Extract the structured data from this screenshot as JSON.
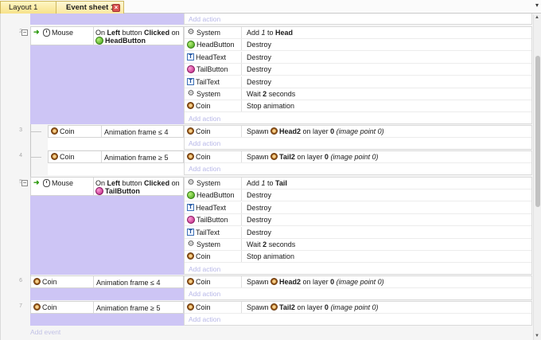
{
  "tabs": [
    {
      "label": "Layout 1"
    },
    {
      "label": "Event sheet 1"
    }
  ],
  "tab_menu_glyph": "▾",
  "tab_close_glyph": "×",
  "add_action_label": "Add action",
  "add_event_label": "Add event",
  "collapse_glyph": "−",
  "events": [
    {
      "num": "2",
      "cond_object": "Mouse",
      "cond_parts": [
        "On ",
        "Left",
        " button ",
        "Clicked",
        " on"
      ],
      "cond_target": "HeadButton",
      "actions": [
        {
          "icon": "gear-icon",
          "object": "System",
          "text": [
            "Add ",
            "1",
            " to ",
            "Head"
          ]
        },
        {
          "icon": "green-button-icon",
          "object": "HeadButton",
          "text": [
            "Destroy"
          ]
        },
        {
          "icon": "text-icon",
          "object": "HeadText",
          "text": [
            "Destroy"
          ]
        },
        {
          "icon": "pink-button-icon",
          "object": "TailButton",
          "text": [
            "Destroy"
          ]
        },
        {
          "icon": "text-icon",
          "object": "TailText",
          "text": [
            "Destroy"
          ]
        },
        {
          "icon": "gear-icon",
          "object": "System",
          "text": [
            "Wait ",
            "2",
            " seconds"
          ]
        },
        {
          "icon": "coin-icon",
          "object": "Coin",
          "text": [
            "Stop animation"
          ]
        }
      ]
    },
    {
      "num": "3",
      "cond_object": "Coin",
      "cond_text": "Animation frame ≤ 4",
      "actions": [
        {
          "icon": "coin-icon",
          "object": "Coin",
          "text": [
            "Spawn ",
            "Head2",
            " on layer ",
            "0",
            " ",
            "(image point 0)"
          ]
        }
      ]
    },
    {
      "num": "4",
      "cond_object": "Coin",
      "cond_text": "Animation frame ≥ 5",
      "actions": [
        {
          "icon": "coin-icon",
          "object": "Coin",
          "text": [
            "Spawn ",
            "Tail2",
            " on layer ",
            "0",
            " ",
            "(image point 0)"
          ]
        }
      ]
    },
    {
      "num": "5",
      "cond_object": "Mouse",
      "cond_parts": [
        "On ",
        "Left",
        " button ",
        "Clicked",
        " on"
      ],
      "cond_target": "TailButton",
      "actions": [
        {
          "icon": "gear-icon",
          "object": "System",
          "text": [
            "Add ",
            "1",
            " to ",
            "Tail"
          ]
        },
        {
          "icon": "green-button-icon",
          "object": "HeadButton",
          "text": [
            "Destroy"
          ]
        },
        {
          "icon": "text-icon",
          "object": "HeadText",
          "text": [
            "Destroy"
          ]
        },
        {
          "icon": "pink-button-icon",
          "object": "TailButton",
          "text": [
            "Destroy"
          ]
        },
        {
          "icon": "text-icon",
          "object": "TailText",
          "text": [
            "Destroy"
          ]
        },
        {
          "icon": "gear-icon",
          "object": "System",
          "text": [
            "Wait ",
            "2",
            " seconds"
          ]
        },
        {
          "icon": "coin-icon",
          "object": "Coin",
          "text": [
            "Stop animation"
          ]
        }
      ]
    },
    {
      "num": "6",
      "cond_object": "Coin",
      "cond_text": "Animation frame ≤ 4",
      "actions": [
        {
          "icon": "coin-icon",
          "object": "Coin",
          "text": [
            "Spawn ",
            "Head2",
            " on layer ",
            "0",
            " ",
            "(image point 0)"
          ]
        }
      ]
    },
    {
      "num": "7",
      "cond_object": "Coin",
      "cond_text": "Animation frame ≥ 5",
      "actions": [
        {
          "icon": "coin-icon",
          "object": "Coin",
          "text": [
            "Spawn ",
            "Tail2",
            " on layer ",
            "0",
            " ",
            "(image point 0)"
          ]
        }
      ]
    }
  ],
  "colors": {
    "condition_block": "#cdc5f5",
    "add_action_text": "#b7b7e8",
    "tab_active": "#fbe9a0"
  }
}
